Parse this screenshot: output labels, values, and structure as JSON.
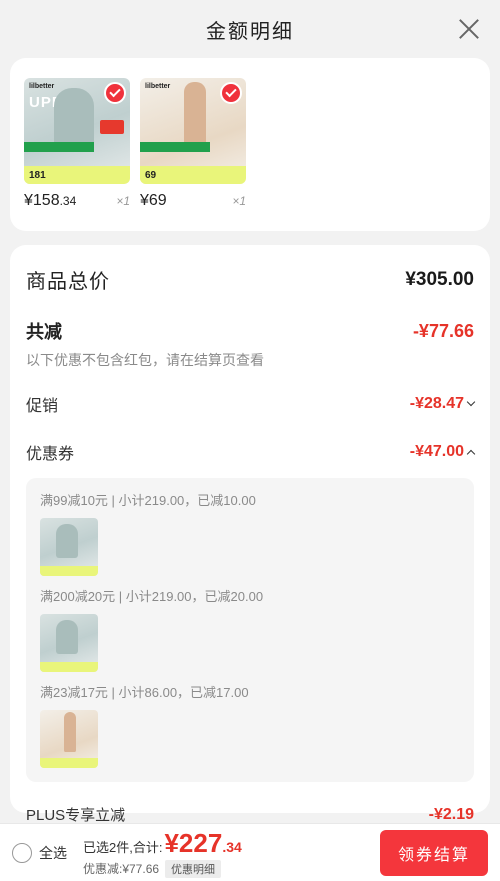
{
  "header": {
    "title": "金额明细"
  },
  "products": [
    {
      "price_int": "¥158",
      "price_dec": ".34",
      "qty": "×1",
      "brand": "lilbetter",
      "upf": "UPF",
      "band": "181"
    },
    {
      "price_int": "¥69",
      "price_dec": "",
      "qty": "×1",
      "brand": "lilbetter",
      "band": "69"
    }
  ],
  "detail": {
    "total_label": "商品总价",
    "total_value": "¥305.00",
    "discount_label": "共减",
    "discount_value": "-¥77.66",
    "note": "以下优惠不包含红包，请在结算页查看",
    "promo_label": "促销",
    "promo_value": "-¥28.47",
    "coupon_label": "优惠券",
    "coupon_value": "-¥47.00",
    "coupon_lines": [
      "满99减10元 | 小计219.00，已减10.00",
      "满200减20元 | 小计219.00，已减20.00",
      "满23减17元 | 小计86.00，已减17.00"
    ],
    "plus_label": "PLUS专享立减",
    "plus_value": "-¥2.19"
  },
  "footer": {
    "select_all": "全选",
    "selected_text": "已选2件,合计:",
    "pay_int": "¥227",
    "pay_dec": ".34",
    "saved_text": "优惠减:¥77.66",
    "detail_tag": "优惠明细",
    "checkout": "领券结算"
  },
  "colors": {
    "accent": "#e63329",
    "button": "#f4363c"
  }
}
